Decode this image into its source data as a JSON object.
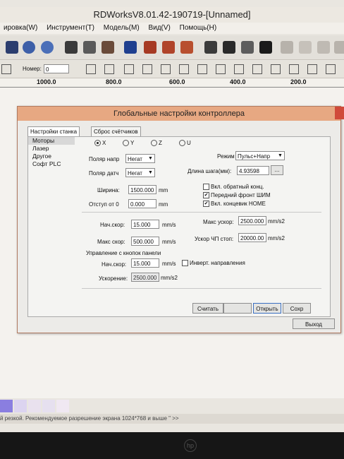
{
  "app": {
    "title": "RDWorksV8.01.42-190719-[Unnamed]"
  },
  "menu": [
    "ировка(W)",
    "Инструмент(T)",
    "Модель(M)",
    "Вид(V)",
    "Помощь(H)"
  ],
  "toolbar2": {
    "number_label": "Номер:",
    "number_value": "0"
  },
  "ruler": [
    "1000.0",
    "800.0",
    "600.0",
    "400.0",
    "200.0"
  ],
  "dialog": {
    "title": "Глобальные настройки контроллера",
    "tabs": [
      "Настройки станка",
      "Сброс счётчиков"
    ],
    "categories": [
      "Моторы",
      "Лазер",
      "Другое",
      "Софт PLC"
    ],
    "axes": [
      "X",
      "Y",
      "Z",
      "U"
    ],
    "selected_axis": "X",
    "dir_polarity_label": "Поляр напр",
    "dir_polarity_value": "Негат",
    "sensor_polarity_label": "Поляр датч",
    "sensor_polarity_value": "Негат",
    "mode_label": "Режим",
    "mode_value": "Пульс+Напр",
    "step_label": "Длина шага(мм):",
    "step_value": "4.93598",
    "step_btn": "...",
    "width_label": "Ширина:",
    "width_value": "1500.000",
    "width_unit": "mm",
    "offset_label": "Отступ от 0",
    "offset_value": "0.000",
    "offset_unit": "mm",
    "chk_reverse": "Вкл. обратный конц.",
    "chk_pwm": "Передний фронт ШИМ",
    "chk_home": "Вкл. концевик HOME",
    "start_speed_label": "Нач.скор:",
    "start_speed_value": "15.000",
    "start_speed_unit": "mm/s",
    "max_speed_label": "Макс скор:",
    "max_speed_value": "500.000",
    "max_speed_unit": "mm/s",
    "max_accel_label": "Макс ускор:",
    "max_accel_value": "2500.000",
    "max_accel_unit": "mm/s2",
    "estop_accel_label": "Ускор ЧП стоп:",
    "estop_accel_value": "20000.00",
    "estop_accel_unit": "mm/s2",
    "panel_section_label": "Управление с кнопок панели",
    "panel_start_speed_label": "Нач.скор:",
    "panel_start_speed_value": "15.000",
    "panel_start_speed_unit": "mm/s",
    "chk_invert": "Инверт. направления",
    "panel_accel_label": "Ускорение:",
    "panel_accel_value": "2500.000",
    "panel_accel_unit": "mm/s2",
    "btn_read": "Считать",
    "btn_open": "Открыть",
    "btn_save": "Сохр",
    "btn_exit": "Выход"
  },
  "status": {
    "text": "й резкой. Рекомендуемое разрешение экрана 1024*768 и выше \" >>"
  },
  "colors": {
    "dialog_title_bg": "#e7a882",
    "swatches": [
      "#8a7ee0",
      "#dcd4f0",
      "#e9e1ee",
      "#e6e0ef",
      "#f0e8f2"
    ]
  }
}
